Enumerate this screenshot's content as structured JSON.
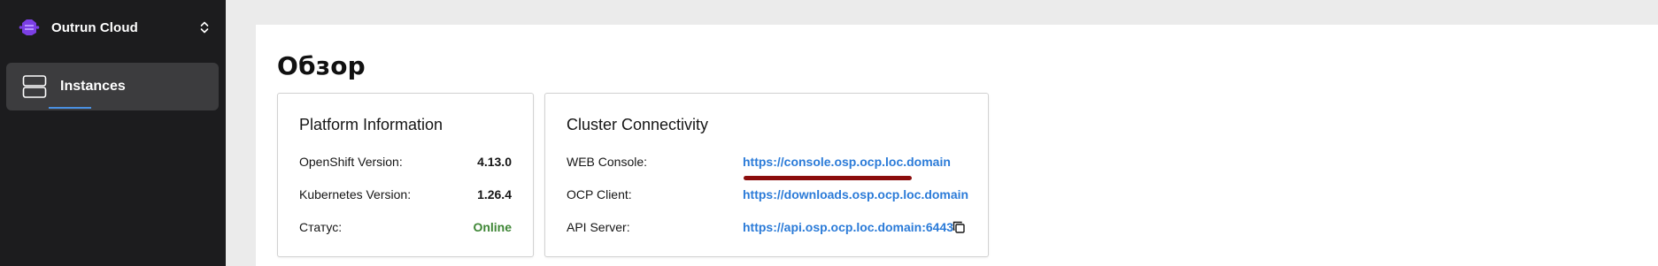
{
  "sidebar": {
    "brand_name": "Outrun Cloud",
    "brand_icon": "outrun-logo-icon",
    "toggle_icon": "chevron-up-down-icon",
    "items": [
      {
        "label": "Instances",
        "icon": "server-stack-icon",
        "active": true
      }
    ]
  },
  "main": {
    "title": "Обзор",
    "platform_card": {
      "title": "Platform Information",
      "rows": [
        {
          "label": "OpenShift Version:",
          "value": "4.13.0"
        },
        {
          "label": "Kubernetes Version:",
          "value": "1.26.4"
        },
        {
          "label": "Статус:",
          "value": "Online",
          "status_color": "#3e8635"
        }
      ]
    },
    "cluster_card": {
      "title": "Cluster Connectivity",
      "rows": [
        {
          "label": "WEB Console:",
          "value": "https://console.osp.ocp.loc.domain",
          "highlighted": true
        },
        {
          "label": "OCP Client:",
          "value": "https://downloads.osp.ocp.loc.domain"
        },
        {
          "label": "API Server:",
          "value": "https://api.osp.ocp.loc.domain:6443",
          "copy_icon": "copy-icon"
        }
      ]
    }
  },
  "colors": {
    "sidebar_bg": "#1c1c1e",
    "active_item_bg": "#3c3c3e",
    "link": "#2b7bd8",
    "online": "#3e8635",
    "highlight_underline": "#8b0d0d",
    "brand_purple": "#7b3fe4"
  }
}
